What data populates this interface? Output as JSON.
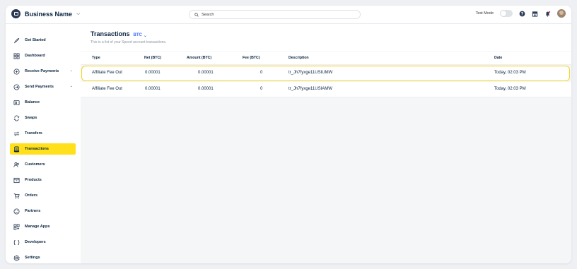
{
  "header": {
    "business_name": "Business Name",
    "search_placeholder": "Search",
    "test_mode_label": "Test Mode"
  },
  "sidebar": {
    "items": [
      {
        "label": "Get Started",
        "icon": "rocket-icon",
        "active": false,
        "expandable": false
      },
      {
        "label": "Dashboard",
        "icon": "grid-icon",
        "active": false,
        "expandable": false
      },
      {
        "label": "Receive Payments",
        "icon": "plus-circle-icon",
        "active": false,
        "expandable": true
      },
      {
        "label": "Send Payments",
        "icon": "arrow-circle-icon",
        "active": false,
        "expandable": true
      },
      {
        "label": "Balance",
        "icon": "wallet-icon",
        "active": false,
        "expandable": false
      },
      {
        "label": "Swaps",
        "icon": "swap-icon",
        "active": false,
        "expandable": false
      },
      {
        "label": "Transfers",
        "icon": "transfer-icon",
        "active": false,
        "expandable": false
      },
      {
        "label": "Transactions",
        "icon": "receipt-icon",
        "active": true,
        "expandable": false
      },
      {
        "label": "Customers",
        "icon": "users-icon",
        "active": false,
        "expandable": false
      },
      {
        "label": "Products",
        "icon": "box-icon",
        "active": false,
        "expandable": false
      },
      {
        "label": "Orders",
        "icon": "cart-icon",
        "active": false,
        "expandable": false
      },
      {
        "label": "Partners",
        "icon": "smile-icon",
        "active": false,
        "expandable": false
      },
      {
        "label": "Manage Apps",
        "icon": "apps-icon",
        "active": false,
        "expandable": false
      },
      {
        "label": "Developers",
        "icon": "code-icon",
        "active": false,
        "expandable": false
      },
      {
        "label": "Settings",
        "icon": "gear-icon",
        "active": false,
        "expandable": false
      }
    ]
  },
  "page": {
    "title": "Transactions",
    "currency": "BTC",
    "subtitle": "This is a list of your Speed account transactions."
  },
  "table": {
    "columns": [
      "Type",
      "Net (BTC)",
      "Amount  (BTC)",
      "Fee  (BTC)",
      "Description",
      "Date"
    ],
    "rows": [
      {
        "type": "Affiliate Fee Out",
        "net": "0.00001",
        "amount": "0.00001",
        "fee": "0",
        "description": "tr_Jh7fyxge11USIUMW",
        "date": "Today, 02:03 PM",
        "highlighted": true
      },
      {
        "type": "Affiliate Fee Out",
        "net": "0.00001",
        "amount": "0.00001",
        "fee": "0",
        "description": "tr_Jh7fyxge11USIAMW",
        "date": "Today, 02:03 PM",
        "highlighted": false
      }
    ]
  },
  "colors": {
    "active_bg": "#ffe01b",
    "highlight_border": "#f5d41f",
    "accent": "#3b6bff",
    "text": "#0a2540"
  }
}
